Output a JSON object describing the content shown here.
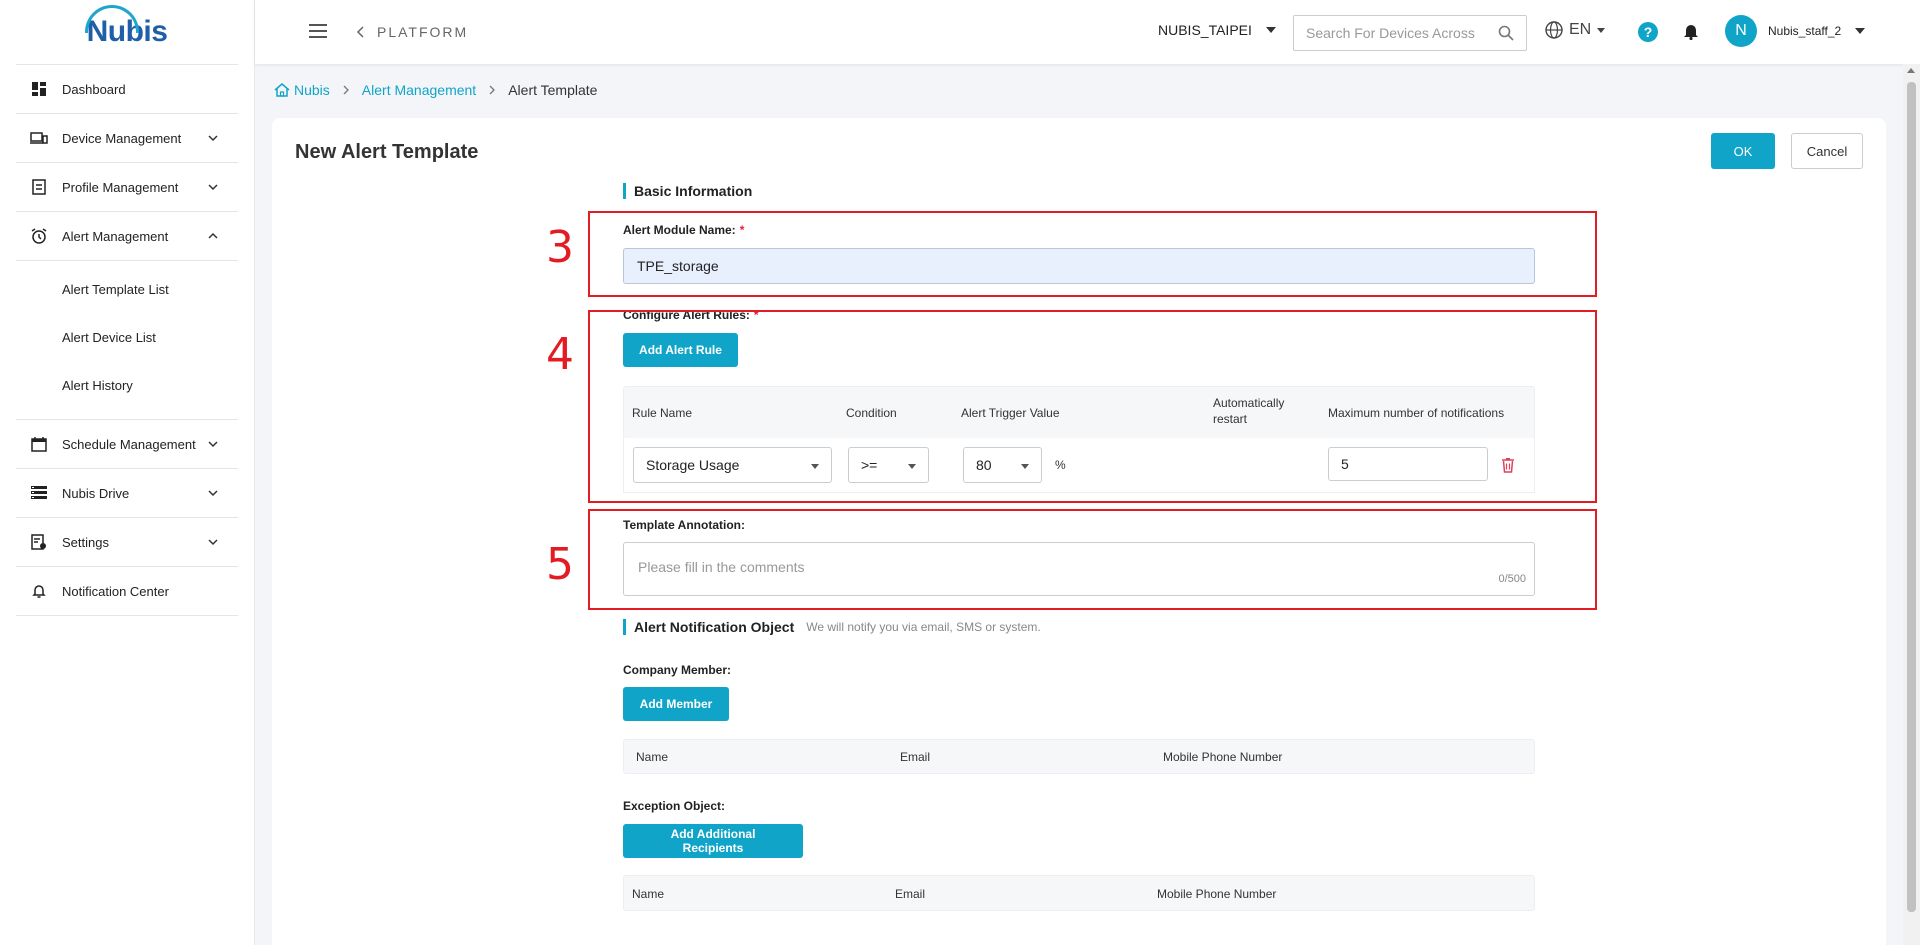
{
  "brand": {
    "logo_text": "Nubis"
  },
  "sidebar": {
    "items": [
      {
        "label": "Dashboard",
        "icon": "dashboard-icon"
      },
      {
        "label": "Device Management",
        "icon": "devices-icon"
      },
      {
        "label": "Profile Management",
        "icon": "profile-icon"
      },
      {
        "label": "Alert Management",
        "icon": "alarm-clock-icon"
      },
      {
        "label": "Schedule Management",
        "icon": "calendar-icon"
      },
      {
        "label": "Nubis Drive",
        "icon": "drive-icon"
      },
      {
        "label": "Settings",
        "icon": "settings-doc-icon"
      },
      {
        "label": "Notification Center",
        "icon": "bell-outline-icon"
      }
    ],
    "alert_sub_items": [
      "Alert Template List",
      "Alert Device List",
      "Alert History"
    ]
  },
  "topbar": {
    "platform_label": "PLATFORM",
    "organization": "NUBIS_TAIPEI",
    "search_placeholder": "Search For Devices Across",
    "language": "EN",
    "help_label": "?",
    "avatar_initial": "N",
    "username": "Nubis_staff_2"
  },
  "breadcrumb": {
    "home": "Nubis",
    "section": "Alert Management",
    "current": "Alert Template"
  },
  "page": {
    "title": "New Alert Template",
    "ok_label": "OK",
    "cancel_label": "Cancel"
  },
  "basic_info": {
    "heading": "Basic Information",
    "module_name_label": "Alert Module Name:",
    "module_name_value": "TPE_storage",
    "rules_label": "Configure Alert Rules:",
    "add_rule_label": "Add Alert Rule",
    "required_mark": "*",
    "rules_table": {
      "headers": [
        "Rule Name",
        "Condition",
        "Alert Trigger Value",
        "Automatically restart",
        "Maximum number of notifications"
      ],
      "rows": [
        {
          "rule_name": "Storage Usage",
          "condition": ">=",
          "trigger_value": "80",
          "unit": "%",
          "max_notifications": "5"
        }
      ]
    },
    "annotation_label": "Template Annotation:",
    "annotation_placeholder": "Please fill in the comments",
    "annotation_count": "0/500"
  },
  "notification": {
    "heading": "Alert Notification Object",
    "subheading": "We will notify you via email, SMS or system.",
    "company_member_label": "Company Member:",
    "add_member_label": "Add Member",
    "member_headers": [
      "Name",
      "Email",
      "Mobile Phone Number"
    ],
    "exception_label": "Exception Object:",
    "add_recipients_label": "Add Additional Recipients",
    "exception_headers": [
      "Name",
      "Email",
      "Mobile Phone Number"
    ]
  },
  "annotations": {
    "step_3": "3",
    "step_4": "4",
    "step_5": "5",
    "highlight_color": "#e31b23"
  },
  "colors": {
    "accent": "#10a5c8",
    "required": "#e0203a"
  }
}
